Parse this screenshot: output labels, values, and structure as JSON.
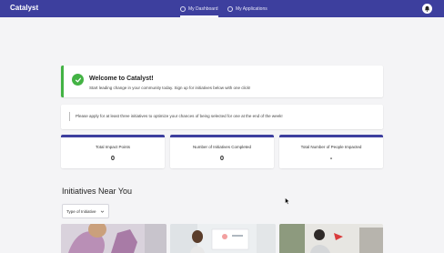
{
  "header": {
    "brand": "Catalyst",
    "tabs": [
      {
        "label": "My Dashboard",
        "active": true
      },
      {
        "label": "My Applications",
        "active": false
      }
    ],
    "icons": {
      "dashboard": "dashboard-icon",
      "applications": "applications-icon",
      "notifications": "bell-icon"
    }
  },
  "welcome": {
    "title": "Welcome to Catalyst!",
    "subtitle": "Start leading change in your community today. Sign up for initiatives below with one click!",
    "icon": "check-circle-icon"
  },
  "notice": {
    "text": "Please apply for at least three initiatives to optimize your chances of being selected for one at the end of the week!"
  },
  "stats": [
    {
      "label": "Total Impact Points",
      "value": "0"
    },
    {
      "label": "Number of Initiatives Completed",
      "value": "0"
    },
    {
      "label": "Total Number of People Impacted",
      "value": "-"
    }
  ],
  "initiatives": {
    "title": "Initiatives Near You",
    "filter": {
      "label": "Type of Initiative"
    }
  },
  "colors": {
    "primary": "#3d3f9e",
    "success": "#43b344",
    "background": "#f4f4f6"
  }
}
